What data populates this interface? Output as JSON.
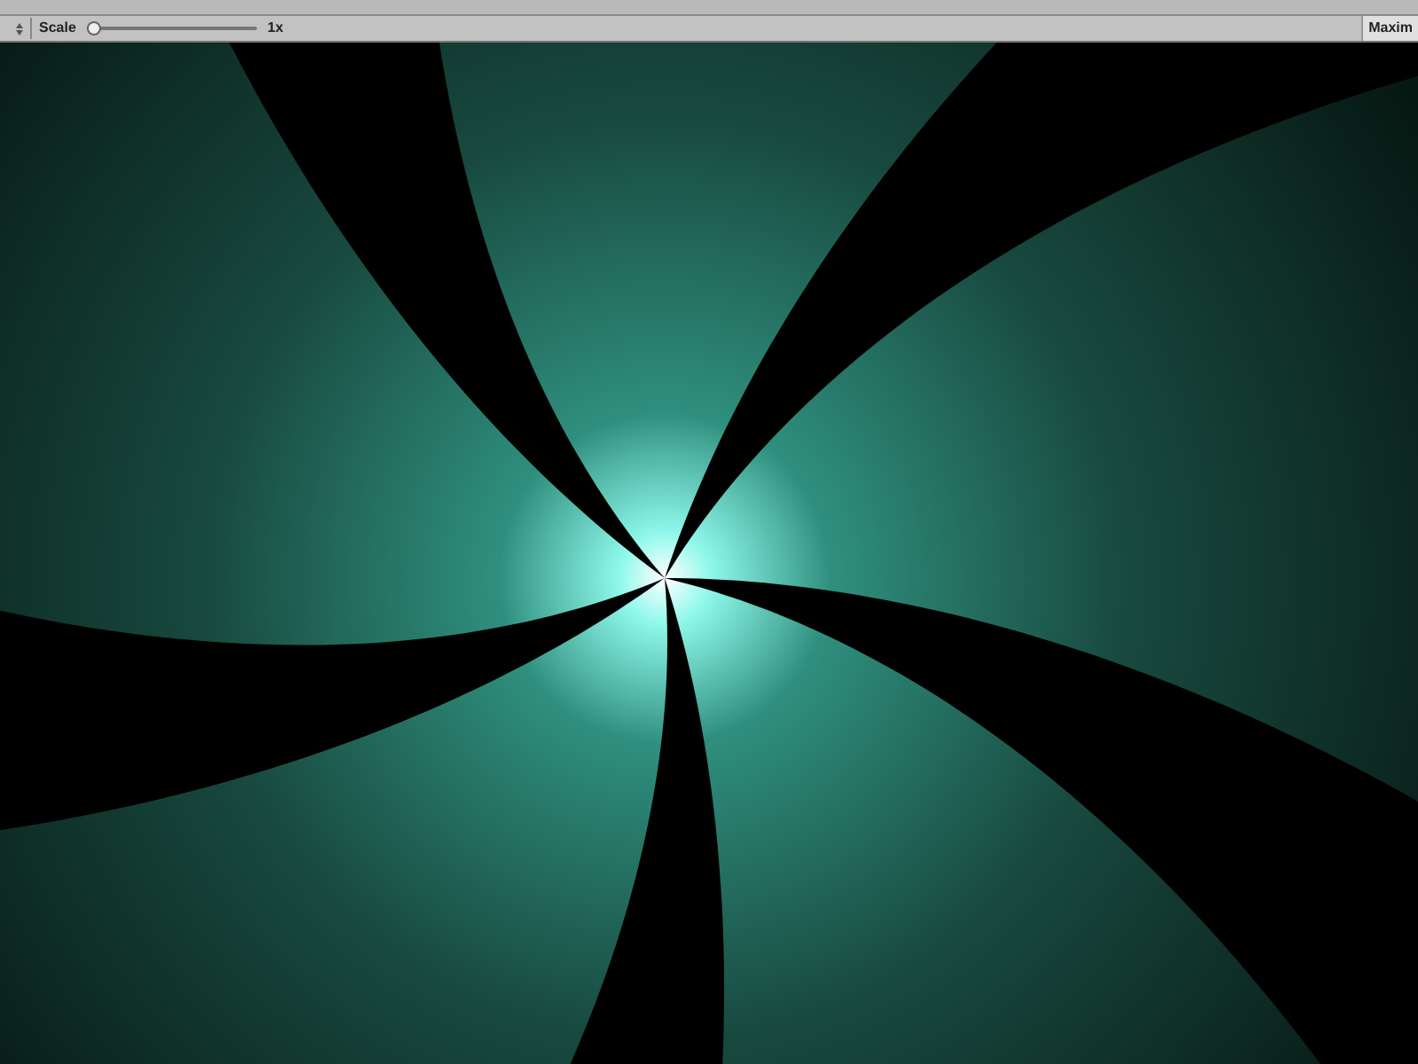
{
  "toolbar": {
    "scale_label": "Scale",
    "scale_slider": {
      "level": 0
    },
    "scale_value": "1x",
    "maximize_button": "Maxim"
  }
}
